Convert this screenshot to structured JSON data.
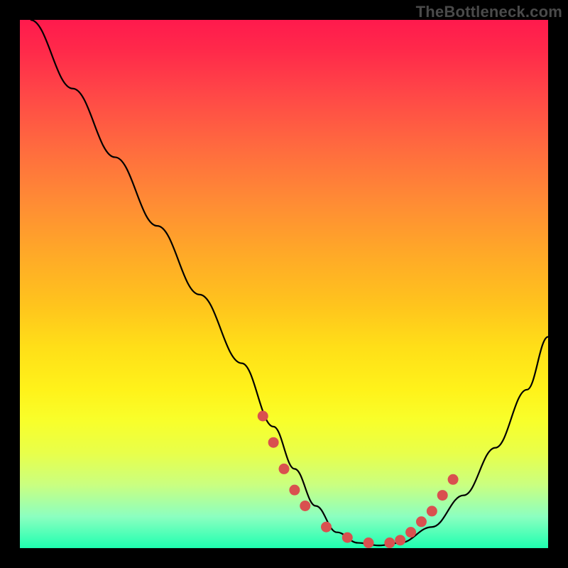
{
  "watermark": "TheBottleneck.com",
  "chart_data": {
    "type": "line",
    "title": "",
    "xlabel": "",
    "ylabel": "",
    "xlim": [
      0,
      100
    ],
    "ylim": [
      0,
      100
    ],
    "series": [
      {
        "name": "bottleneck-curve",
        "x": [
          2,
          10,
          18,
          26,
          34,
          42,
          48,
          52,
          56,
          60,
          64,
          68,
          72,
          78,
          84,
          90,
          96,
          100
        ],
        "y": [
          100,
          87,
          74,
          61,
          48,
          35,
          23,
          15,
          8,
          3,
          1,
          0.5,
          1,
          4,
          10,
          19,
          30,
          40
        ]
      }
    ],
    "markers": {
      "name": "highlight-dots",
      "color": "#d9504f",
      "x": [
        46,
        48,
        50,
        52,
        54,
        58,
        62,
        66,
        70,
        72,
        74,
        76,
        78,
        80,
        82
      ],
      "y": [
        25,
        20,
        15,
        11,
        8,
        4,
        2,
        1,
        1,
        1.5,
        3,
        5,
        7,
        10,
        13
      ]
    },
    "gradient_stops": [
      {
        "pct": 0,
        "color": "#ff1a4d"
      },
      {
        "pct": 50,
        "color": "#ffd418"
      },
      {
        "pct": 100,
        "color": "#1effb0"
      }
    ]
  }
}
